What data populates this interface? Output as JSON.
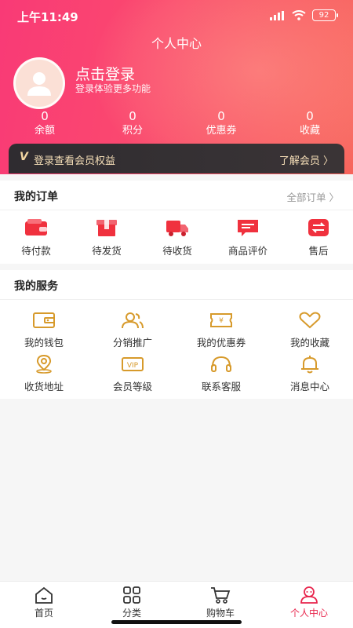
{
  "status_bar": {
    "time": "上午11:49",
    "battery": "92"
  },
  "header": {
    "title": "个人中心",
    "login_title": "点击登录",
    "login_subtitle": "登录体验更多功能"
  },
  "stats": [
    {
      "value": "0",
      "label": "余额"
    },
    {
      "value": "0",
      "label": "积分"
    },
    {
      "value": "0",
      "label": "优惠券"
    },
    {
      "value": "0",
      "label": "收藏"
    }
  ],
  "member_bar": {
    "badge": "V",
    "text": "登录查看会员权益",
    "link": "了解会员 〉"
  },
  "orders": {
    "title": "我的订单",
    "link": "全部订单 〉",
    "items": [
      {
        "label": "待付款",
        "icon": "wallet-icon"
      },
      {
        "label": "待发货",
        "icon": "box-icon"
      },
      {
        "label": "待收货",
        "icon": "truck-icon"
      },
      {
        "label": "商品评价",
        "icon": "comment-icon"
      },
      {
        "label": "售后",
        "icon": "exchange-icon"
      }
    ]
  },
  "services": {
    "title": "我的服务",
    "items": [
      {
        "label": "我的钱包",
        "icon": "wallet-outline-icon"
      },
      {
        "label": "分销推广",
        "icon": "people-icon"
      },
      {
        "label": "我的优惠券",
        "icon": "coupon-icon"
      },
      {
        "label": "我的收藏",
        "icon": "heart-icon"
      },
      {
        "label": "收货地址",
        "icon": "location-icon"
      },
      {
        "label": "会员等级",
        "icon": "vip-icon"
      },
      {
        "label": "联系客服",
        "icon": "headset-icon"
      },
      {
        "label": "消息中心",
        "icon": "bell-icon"
      }
    ]
  },
  "tabbar": [
    {
      "label": "首页",
      "icon": "home-icon"
    },
    {
      "label": "分类",
      "icon": "grid-icon"
    },
    {
      "label": "购物车",
      "icon": "cart-icon"
    },
    {
      "label": "个人中心",
      "icon": "user-icon"
    }
  ],
  "colors": {
    "accent": "#e8264d",
    "gold": "#d79a2b",
    "header_start": "#f93a76",
    "header_end": "#f7655c"
  }
}
